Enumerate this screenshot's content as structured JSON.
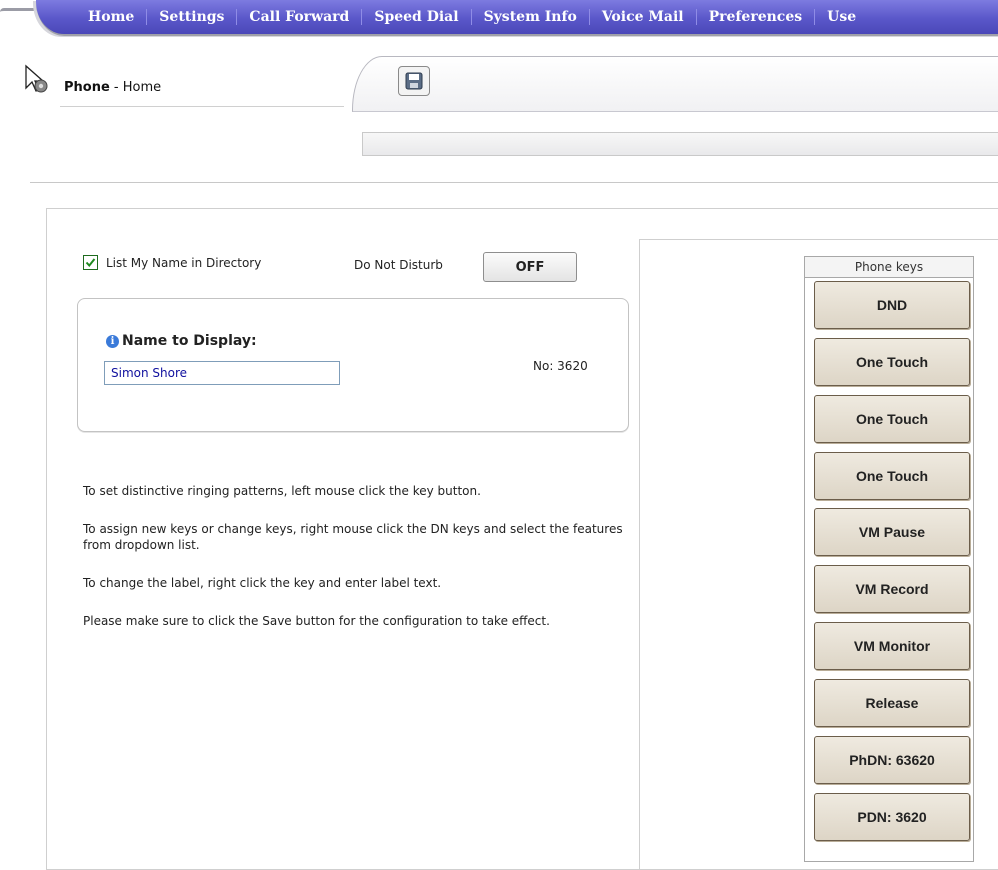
{
  "nav": {
    "items": [
      "Home",
      "Settings",
      "Call Forward",
      "Speed Dial",
      "System Info",
      "Voice Mail",
      "Preferences",
      "Use"
    ]
  },
  "header": {
    "title_bold": "Phone",
    "title_sep": " - ",
    "title_page": "Home"
  },
  "directory": {
    "label": "List My Name in Directory",
    "checked": true
  },
  "dnd": {
    "label": "Do Not Disturb",
    "button": "OFF"
  },
  "name_box": {
    "label": "Name to Display:",
    "value": "Simon Shore",
    "number": "No: 3620"
  },
  "help": [
    "To set distinctive ringing patterns, left mouse click the key button.",
    "To assign new keys or change keys, right mouse click the DN keys and select the features from dropdown list.",
    "To change the label, right click the key and enter label text.",
    "Please make sure to click the Save button for the configuration to take effect."
  ],
  "keys": {
    "header": "Phone keys",
    "items": [
      "DND",
      "One Touch",
      "One Touch",
      "One Touch",
      "VM Pause",
      "VM Record",
      "VM Monitor",
      "Release",
      "PhDN: 63620",
      "PDN: 3620"
    ]
  },
  "colors": {
    "nav_bg": "#5a57c9",
    "checkbox_check": "#1e8a1e",
    "key_bg": "#e6e0d3",
    "info_icon": "#3a7ad9"
  }
}
